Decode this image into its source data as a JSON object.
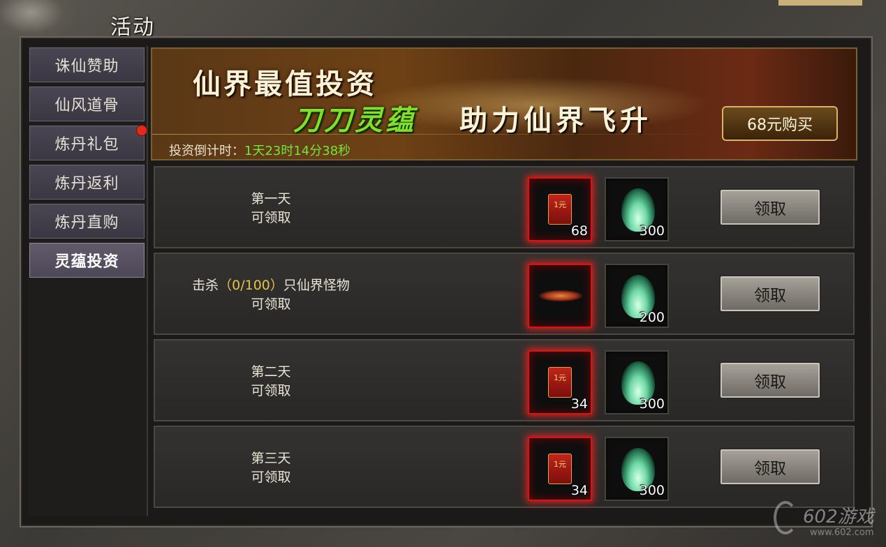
{
  "window": {
    "title": "活动"
  },
  "sidebar": {
    "items": [
      {
        "label": "诛仙赞助"
      },
      {
        "label": "仙风道骨"
      },
      {
        "label": "炼丹礼包"
      },
      {
        "label": "炼丹返利"
      },
      {
        "label": "炼丹直购"
      },
      {
        "label": "灵蕴投资"
      }
    ],
    "active_index": 5,
    "notification_index": 2
  },
  "banner": {
    "headline": "仙界最值投资",
    "tagline_highlight": "刀刀灵蕴",
    "tagline_rest": "助力仙界飞升",
    "countdown_label": "投资倒计时：",
    "countdown_value": "1天23时14分38秒",
    "buy_label": "68元购买"
  },
  "rows": [
    {
      "cond_line1": "第一天",
      "cond_line2": "可领取",
      "reward1_icon": "red-envelope-icon",
      "reward1_text": "1元",
      "reward1_count": "68",
      "reward2_icon": "spirit-flame-icon",
      "reward2_count": "300",
      "claim_label": "领取"
    },
    {
      "cond_pre": "击杀",
      "cond_num": "（0/100）",
      "cond_post": "只仙界怪物",
      "cond_line2": "可领取",
      "reward1_icon": "wings-icon",
      "reward2_icon": "spirit-flame-icon",
      "reward2_count": "200",
      "claim_label": "领取"
    },
    {
      "cond_line1": "第二天",
      "cond_line2": "可领取",
      "reward1_icon": "red-envelope-icon",
      "reward1_text": "1元",
      "reward1_count": "34",
      "reward2_icon": "spirit-flame-icon",
      "reward2_count": "300",
      "claim_label": "领取"
    },
    {
      "cond_line1": "第三天",
      "cond_line2": "可领取",
      "reward1_icon": "red-envelope-icon",
      "reward1_text": "1元",
      "reward1_count": "34",
      "reward2_icon": "spirit-flame-icon",
      "reward2_count": "300",
      "claim_label": "领取"
    }
  ],
  "watermark": {
    "brand": "602游戏",
    "url": "www.602.com"
  },
  "colors": {
    "accent_green": "#6fe73a",
    "highlight_gold": "#e5c04a",
    "notify_red": "#e02a1a"
  }
}
